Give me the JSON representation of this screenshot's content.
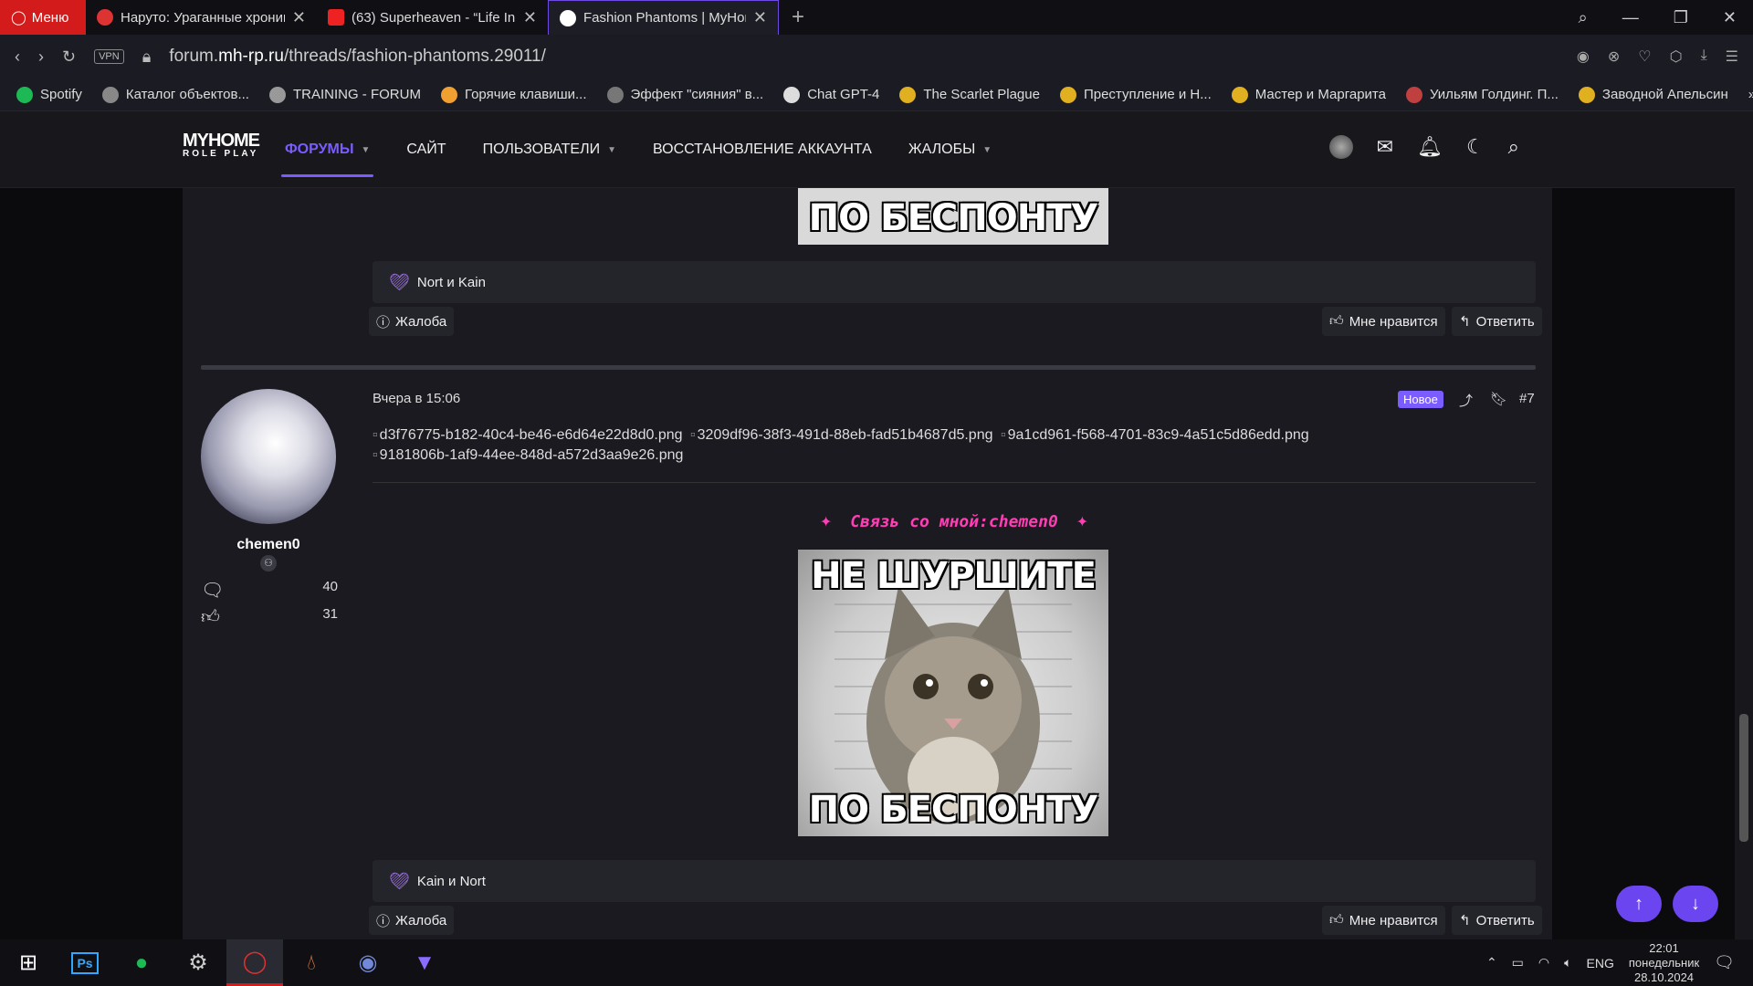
{
  "browser": {
    "menu_label": "Меню",
    "tabs": [
      {
        "title": "Наруто: Ураганные хроники",
        "active": false
      },
      {
        "title": "(63) Superheaven - “Life In",
        "active": false
      },
      {
        "title": "Fashion Phantoms | MyHome",
        "active": true
      }
    ],
    "vpn_label": "VPN",
    "url_prefix": "forum.",
    "url_domain": "mh-rp.ru",
    "url_path": "/threads/fashion-phantoms.29011/"
  },
  "bookmarks": [
    {
      "label": "Spotify",
      "color": "#1db954"
    },
    {
      "label": "Каталог объектов...",
      "color": "#888888"
    },
    {
      "label": "TRAINING - FORUM",
      "color": "#999999"
    },
    {
      "label": "Горячие клавиши...",
      "color": "#f0a030"
    },
    {
      "label": "Эффект \"сияния\" в...",
      "color": "#777777"
    },
    {
      "label": "Chat GPT-4",
      "color": "#dddddd"
    },
    {
      "label": "The Scarlet Plague",
      "color": "#e0b020"
    },
    {
      "label": "Преступление и Н...",
      "color": "#e0b020"
    },
    {
      "label": "Мастер и Маргарита",
      "color": "#e0b020"
    },
    {
      "label": "Уильям Голдинг. П...",
      "color": "#c04040"
    },
    {
      "label": "Заводной Апельсин",
      "color": "#e0b020"
    }
  ],
  "site": {
    "logo_line1": "MYHOME",
    "logo_line2": "ROLE PLAY",
    "nav": [
      {
        "label": "ФОРУМЫ",
        "active": true,
        "dropdown": true
      },
      {
        "label": "САЙТ",
        "active": false,
        "dropdown": false
      },
      {
        "label": "ПОЛЬЗОВАТЕЛИ",
        "active": false,
        "dropdown": true
      },
      {
        "label": "ВОССТАНОВЛЕНИЕ АККАУНТА",
        "active": false,
        "dropdown": false
      },
      {
        "label": "ЖАЛОБЫ",
        "active": false,
        "dropdown": true
      }
    ],
    "accent": "#7b5cff"
  },
  "post_prev": {
    "meme_bottom": "ПО БЕСПОНТУ",
    "reactions": "Nort и Kain",
    "report_label": "Жалоба",
    "like_label": "Мне нравится",
    "reply_label": "Ответить"
  },
  "post": {
    "author": "chemen0",
    "messages_count": "40",
    "likes_count": "31",
    "date": "Вчера в 15:06",
    "new_badge": "Новое",
    "post_number": "#7",
    "files": [
      "d3f76775-b182-40c4-be46-e6d64e22d8d0.png",
      "3209df96-38f3-491d-88eb-fad51b4687d5.png",
      "9a1cd961-f568-4701-83c9-4a51c5d86edd.png",
      "9181806b-1af9-44ee-848d-a572d3aa9e26.png"
    ],
    "contact_text": "Связь со мной:chemen0",
    "meme_top": "НЕ ШУРШИТЕ",
    "meme_bottom": "ПО БЕСПОНТУ",
    "reactions": "Kain и Nort",
    "report_label": "Жалоба",
    "like_label": "Мне нравится",
    "reply_label": "Ответить"
  },
  "taskbar": {
    "lang": "ENG",
    "time": "22:01",
    "weekday": "понедельник",
    "date": "28.10.2024"
  }
}
